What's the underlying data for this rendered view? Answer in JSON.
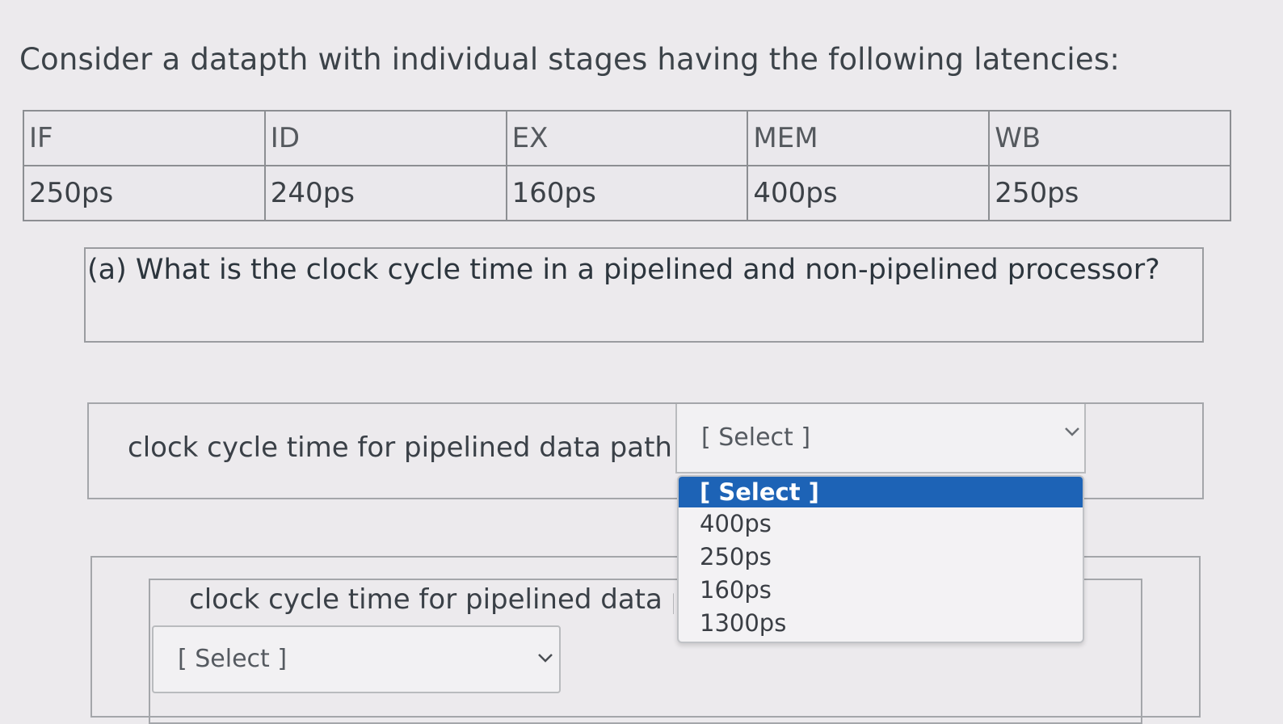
{
  "heading": "Consider a datapth with individual stages having the following latencies:",
  "table": {
    "headers": [
      "IF",
      "ID",
      "EX",
      "MEM",
      "WB"
    ],
    "values": [
      "250ps",
      "240ps",
      "160ps",
      "400ps",
      "250ps"
    ]
  },
  "question": "(a) What is the clock cycle time in a pipelined and non-pipelined processor?",
  "answer1": {
    "label": "clock cycle time for pipelined data path =",
    "selected": "[ Select ]"
  },
  "dropdown": {
    "options": [
      "[ Select ]",
      "400ps",
      "250ps",
      "160ps",
      "1300ps"
    ],
    "highlighted": "[ Select ]"
  },
  "answer2": {
    "label": "clock cycle time for pipelined data pa",
    "selected": "[ Select ]"
  },
  "icons": {
    "dropdown_arrow": "chevron-down-icon"
  },
  "colors": {
    "highlight": "#1d63b6",
    "background": "#eceaed"
  }
}
